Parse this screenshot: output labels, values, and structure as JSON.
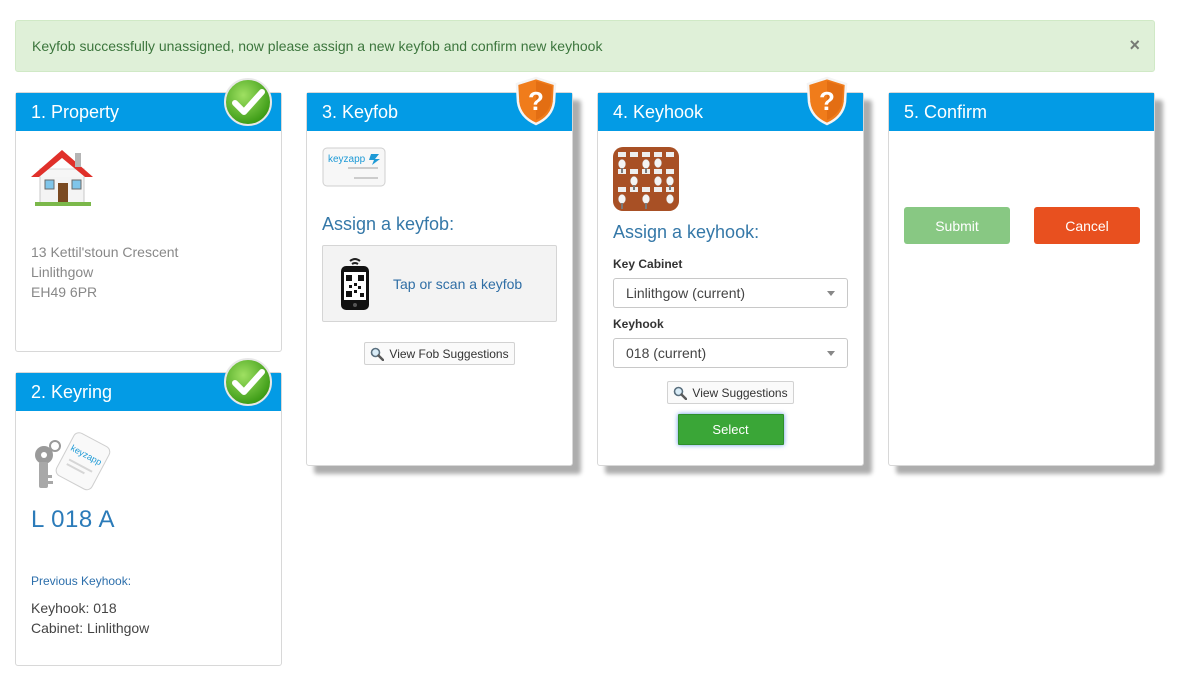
{
  "alert": {
    "message": "Keyfob successfully unassigned, now please assign a new keyfob and confirm new keyhook",
    "close_label": "×"
  },
  "property": {
    "title": "1. Property",
    "address": [
      "13 Kettil'stoun Crescent",
      "Linlithgow",
      "EH49 6PR"
    ]
  },
  "keyring": {
    "title": "2. Keyring",
    "code": "L 018 A",
    "previous_label": "Previous Keyhook:",
    "keyhook_line": "Keyhook: 018",
    "cabinet_line": "Cabinet: Linlithgow",
    "fob_brand": "keyzapp"
  },
  "keyfob": {
    "title": "3. Keyfob",
    "assign_title": "Assign a keyfob:",
    "scan_text": "Tap or scan a keyfob",
    "suggestions_label": "View Fob Suggestions",
    "card_brand": "keyzapp"
  },
  "keyhook": {
    "title": "4. Keyhook",
    "assign_title": "Assign a keyhook:",
    "cabinet_label": "Key Cabinet",
    "cabinet_value": "Linlithgow (current)",
    "keyhook_label": "Keyhook",
    "keyhook_value": "018 (current)",
    "suggestions_label": "View Suggestions",
    "select_label": "Select"
  },
  "confirm": {
    "title": "5. Confirm",
    "submit_label": "Submit",
    "cancel_label": "Cancel"
  },
  "icons": {
    "complete": "check-badge-icon",
    "pending": "question-shield-icon"
  },
  "colors": {
    "header_blue": "#039be5",
    "success_bg": "#dff0d8",
    "success_text": "#3c763d",
    "select_green": "#3aa637",
    "submit_green": "#88c883",
    "cancel_orange": "#e8501f",
    "pending_orange": "#f07c1b"
  }
}
